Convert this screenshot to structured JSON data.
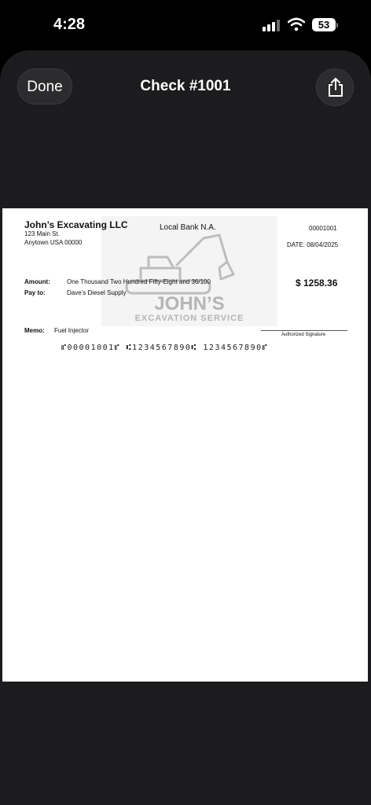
{
  "status_bar": {
    "time": "4:28",
    "battery": "53"
  },
  "nav": {
    "done_label": "Done",
    "title": "Check #1001"
  },
  "check": {
    "company_name": "John’s Excavating LLC",
    "address_line1": "123 Main St.",
    "address_line2": "Anytown USA 00000",
    "bank_name": "Local Bank N.A.",
    "check_number": "00001001",
    "date": "DATE: 08/04/2025",
    "amount_label": "Amount:",
    "amount_words": "One Thousand Two Hundred Fifty-Eight and 36/100",
    "pay_to_label": "Pay to:",
    "payee": "Dave’s Diesel Supply",
    "amount_numeric": "$ 1258.36",
    "memo_label": "Memo:",
    "memo": "Fuel Injector",
    "signature_label": "Authorized Signature",
    "micr_line": "⑈00001001⑈ ⑆1234567890⑆ 1234567890⑈",
    "watermark": {
      "line1": "JOHN’S",
      "line2": "EXCAVATION SERVICE"
    }
  }
}
